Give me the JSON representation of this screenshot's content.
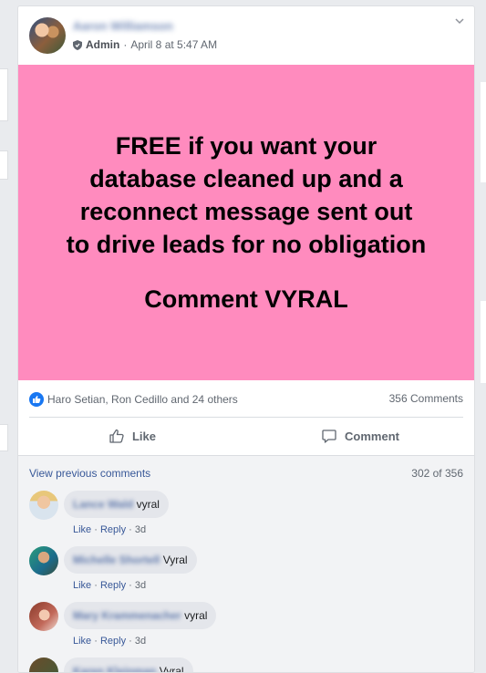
{
  "post": {
    "author_name": "Aaron Williamson",
    "badge": "Admin",
    "timestamp": "April 8 at 5:47 AM",
    "image_text_lines": [
      "FREE if you want your",
      "database cleaned up and a",
      "reconnect message sent out",
      "to drive leads for no obligation"
    ],
    "image_cta": "Comment VYRAL",
    "colors": {
      "image_bg": "#ff8bbe",
      "link": "#385898",
      "like_blue": "#1877f2"
    }
  },
  "stats": {
    "reactions_text": "Haro Setian, Ron Cedillo and 24 others",
    "comments_count": "356 Comments"
  },
  "actions": {
    "like_label": "Like",
    "comment_label": "Comment"
  },
  "comments_section": {
    "view_previous": "View previous comments",
    "page_count": "302 of 356",
    "items": [
      {
        "name": "Lance Wald",
        "text": "vyral",
        "like": "Like",
        "reply": "Reply",
        "time": "3d"
      },
      {
        "name": "Michelle Shortell",
        "text": "Vyral",
        "like": "Like",
        "reply": "Reply",
        "time": "3d"
      },
      {
        "name": "Mary Krammenacher",
        "text": "vyral",
        "like": "Like",
        "reply": "Reply",
        "time": "3d"
      },
      {
        "name": "Karen Kleinman",
        "text": "Vyral"
      }
    ]
  }
}
